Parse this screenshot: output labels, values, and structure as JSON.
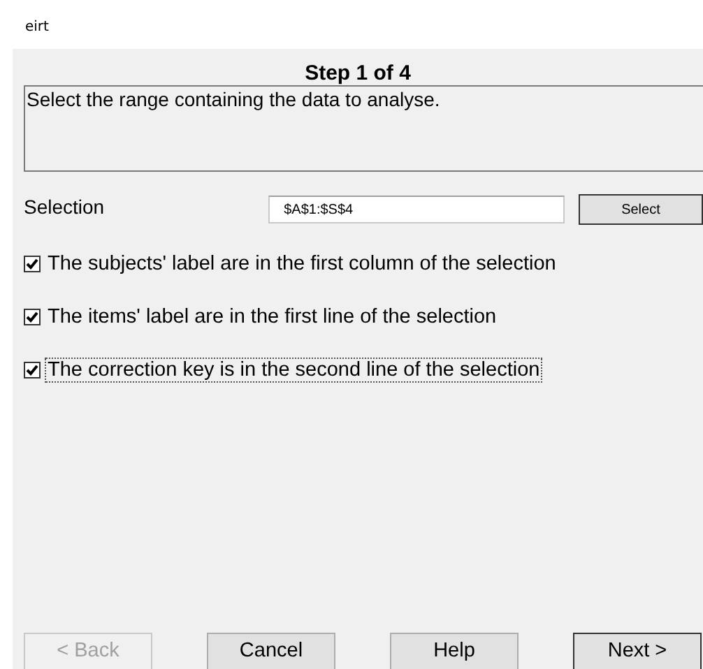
{
  "window": {
    "title": "eirt"
  },
  "step_title": "Step 1 of 4",
  "description": "Select the range containing the data to analyse.",
  "selection": {
    "label": "Selection",
    "value": "$A$1:$S$4",
    "button": "Select"
  },
  "options": [
    {
      "label": "The subjects' label are in the first column of the selection",
      "checked": true,
      "focused": false
    },
    {
      "label": "The items' label are in the first line of the selection",
      "checked": true,
      "focused": false
    },
    {
      "label": "The correction key is in the second line of the selection",
      "checked": true,
      "focused": true
    }
  ],
  "buttons": [
    {
      "label": "< Back",
      "disabled": true,
      "default": false
    },
    {
      "label": "Cancel",
      "disabled": false,
      "default": false
    },
    {
      "label": "Help",
      "disabled": false,
      "default": false
    },
    {
      "label": "Next >",
      "disabled": false,
      "default": true
    }
  ]
}
